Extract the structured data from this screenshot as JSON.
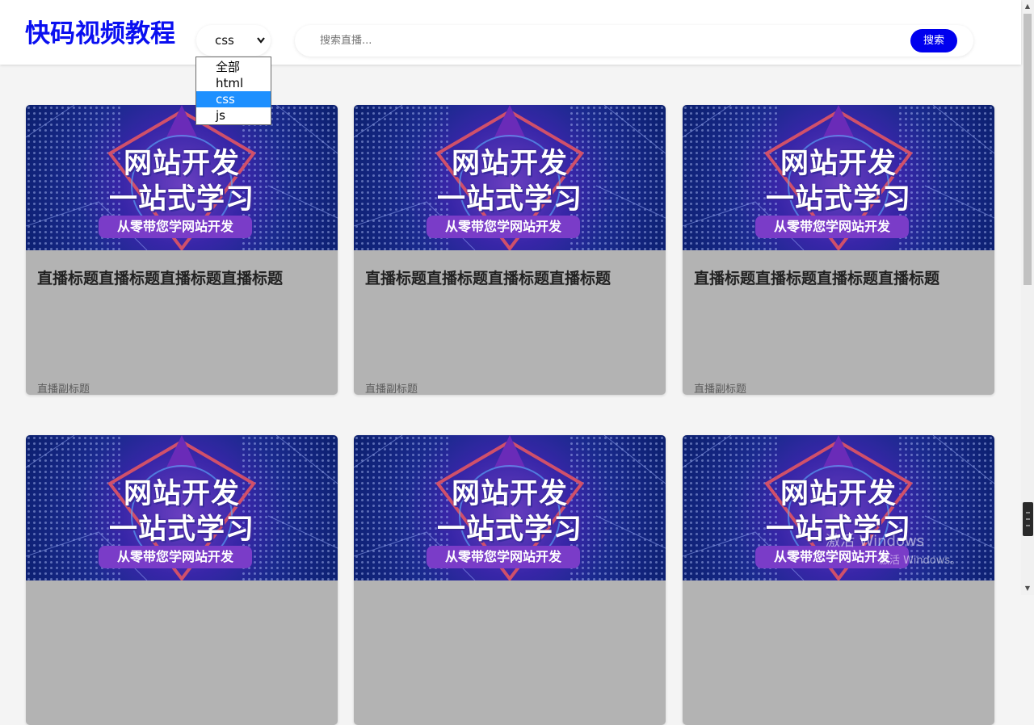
{
  "header": {
    "logo": "快码视频教程",
    "category_select": {
      "value": "css",
      "options": [
        "全部",
        "html",
        "css",
        "js"
      ],
      "selected_index": 2
    },
    "search": {
      "placeholder": "搜索直播...",
      "button_label": "搜索"
    }
  },
  "cards": [
    {
      "thumb_line1": "网站开发",
      "thumb_line2": "一站式学习",
      "thumb_tag": "从零带您学网站开发",
      "title": "直播标题直播标题直播标题直播标题",
      "subtitle": "直播副标题"
    },
    {
      "thumb_line1": "网站开发",
      "thumb_line2": "一站式学习",
      "thumb_tag": "从零带您学网站开发",
      "title": "直播标题直播标题直播标题直播标题",
      "subtitle": "直播副标题"
    },
    {
      "thumb_line1": "网站开发",
      "thumb_line2": "一站式学习",
      "thumb_tag": "从零带您学网站开发",
      "title": "直播标题直播标题直播标题直播标题",
      "subtitle": "直播副标题"
    },
    {
      "thumb_line1": "网站开发",
      "thumb_line2": "一站式学习",
      "thumb_tag": "从零带您学网站开发",
      "title": "",
      "subtitle": ""
    },
    {
      "thumb_line1": "网站开发",
      "thumb_line2": "一站式学习",
      "thumb_tag": "从零带您学网站开发",
      "title": "",
      "subtitle": ""
    },
    {
      "thumb_line1": "网站开发",
      "thumb_line2": "一站式学习",
      "thumb_tag": "从零带您学网站开发",
      "title": "",
      "subtitle": ""
    }
  ],
  "watermark": {
    "line1": "激活 Windows",
    "line2": "激活 Windows。"
  },
  "colors": {
    "brand": "#0a0ff0",
    "search_button": "#0000ee",
    "selected_option": "#1e90ff",
    "card_body": "#b3b3b3",
    "page_background": "#f4f4f4"
  },
  "icons": {
    "select_arrow": "chevron-down-icon",
    "scroll_up": "scroll-up-arrow-icon",
    "scroll_down": "scroll-down-arrow-icon"
  }
}
